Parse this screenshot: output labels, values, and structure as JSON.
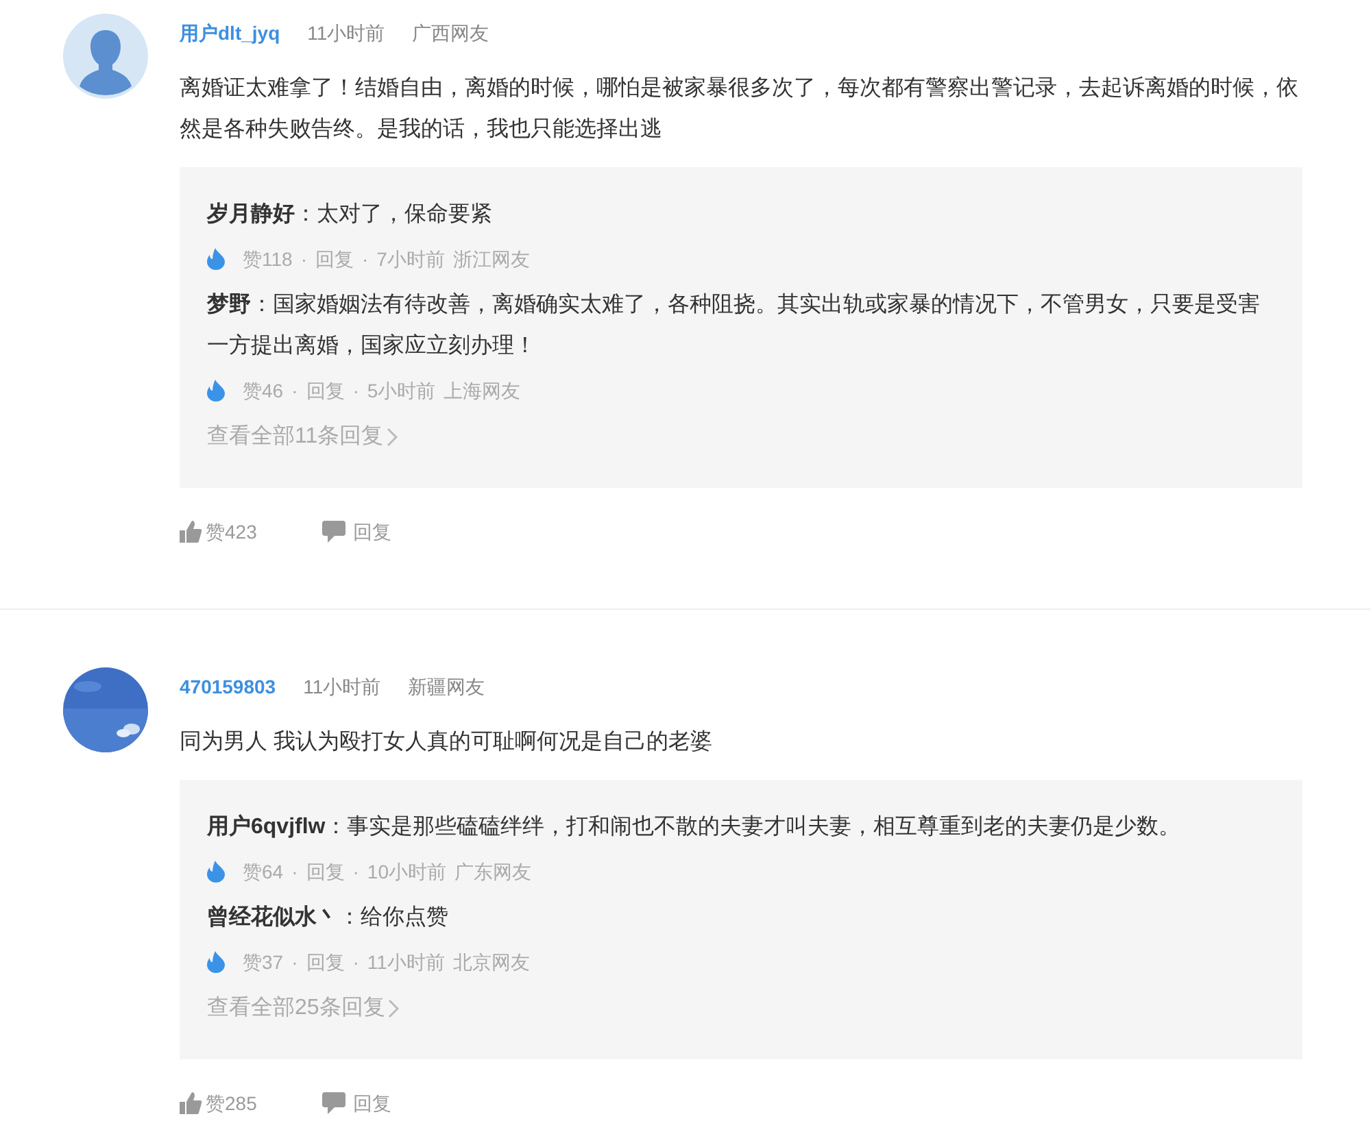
{
  "comments": [
    {
      "avatar": {
        "kind": "silhouette"
      },
      "user": "用户dlt_jyq",
      "time": "11小时前",
      "location": "广西网友",
      "text": "离婚证太难拿了！结婚自由，离婚的时候，哪怕是被家暴很多次了，每次都有警察出警记录，去起诉离婚的时候，依然是各种失败告终。是我的话，我也只能选择出逃",
      "replies": [
        {
          "user": "岁月静好",
          "text": "：太对了，保命要紧",
          "likes": "赞118",
          "sep": "·",
          "reply": "回复",
          "time": "7小时前",
          "location": "浙江网友"
        },
        {
          "user": "梦野",
          "text": "：国家婚姻法有待改善，离婚确实太难了，各种阻挠。其实出轨或家暴的情况下，不管男女，只要是受害一方提出离婚，国家应立刻办理！",
          "likes": "赞46",
          "sep": "·",
          "reply": "回复",
          "time": "5小时前",
          "location": "上海网友"
        }
      ],
      "view_all": "查看全部11条回复",
      "like": "赞423",
      "reply_button": "回复"
    },
    {
      "user": "470159803",
      "time": "11小时前",
      "location": "新疆网友",
      "text": "同为男人 我认为殴打女人真的可耻啊何况是自己的老婆",
      "replies": [
        {
          "user": "用户6qvjflw",
          "text": "：事实是那些磕磕绊绊，打和闹也不散的夫妻才叫夫妻，相互尊重到老的夫妻仍是少数。",
          "likes": "赞64",
          "sep": "·",
          "reply": "回复",
          "time": "10小时前",
          "location": "广东网友"
        },
        {
          "user": "曾经花似水丶",
          "text": "：给你点赞",
          "likes": "赞37",
          "sep": "·",
          "reply": "回复",
          "time": "11小时前",
          "location": "北京网友"
        }
      ],
      "view_all": "查看全部25条回复",
      "like": "赞285",
      "reply_button": "回复"
    }
  ]
}
